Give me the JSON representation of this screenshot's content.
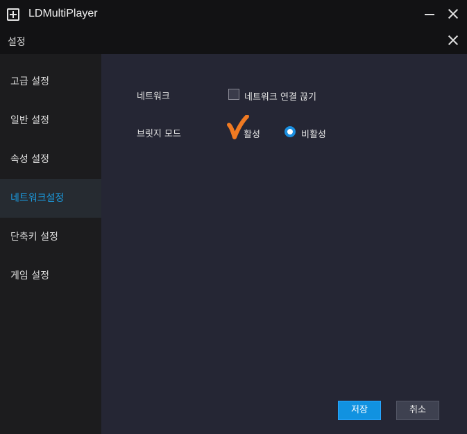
{
  "window": {
    "title": "LDMultiPlayer",
    "icon": "app-plus-icon"
  },
  "dialog": {
    "title": "설정"
  },
  "sidebar": {
    "items": [
      {
        "label": "고급 설정",
        "active": false
      },
      {
        "label": "일반 설정",
        "active": false
      },
      {
        "label": "속성 설정",
        "active": false
      },
      {
        "label": "네트워크설정",
        "active": true
      },
      {
        "label": "단축키 설정",
        "active": false
      },
      {
        "label": "게임 설정",
        "active": false
      }
    ]
  },
  "network": {
    "label": "네트워크",
    "disconnect_label": "네트워크 연결 끊기",
    "disconnect_checked": false
  },
  "bridge": {
    "label": "브릿지 모드",
    "options": [
      {
        "label": "활성",
        "selected": false
      },
      {
        "label": "비활성",
        "selected": true
      }
    ]
  },
  "buttons": {
    "save": "저장",
    "cancel": "취소"
  },
  "colors": {
    "accent": "#1b9be0",
    "annotation": "#f07a22"
  }
}
